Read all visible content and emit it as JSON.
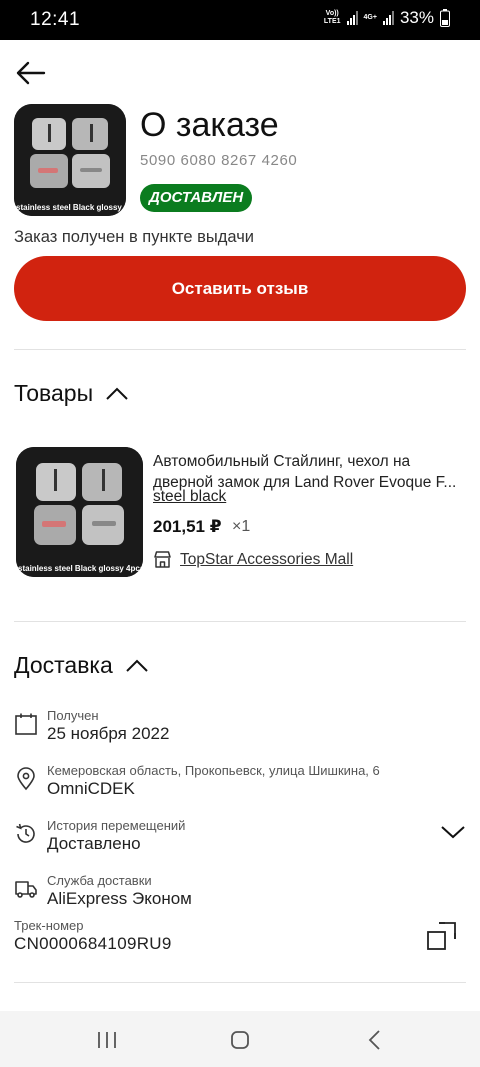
{
  "status_bar": {
    "time": "12:41",
    "network_top": "Vo))",
    "network_bottom": "LTE1",
    "network2": "4G+",
    "battery": "33%"
  },
  "header": {
    "title": "О заказе",
    "order_number": "5090 6080 8267 4260",
    "status_badge": "ДОСТАВЛЕН",
    "note": "Заказ получен в пункте выдачи",
    "review_button": "Оставить отзыв"
  },
  "product_image_caption": "stainless steel Black glossy 4pcs",
  "products": {
    "section_title": "Товары",
    "item": {
      "title": "Автомобильный Стайлинг, чехол на дверной замок для Land Rover Evoque F...",
      "variant": "steel black",
      "price": "201,51 ₽",
      "qty": "×1",
      "store": "TopStar Accessories Mall"
    }
  },
  "delivery": {
    "section_title": "Доставка",
    "received_label": "Получен",
    "received_value": "25 ноября 2022",
    "address_label": "Кемеровская область, Прокопьевск, улица Шишкина, 6",
    "address_value": "OmniCDEK",
    "history_label": "История перемещений",
    "history_value": "Доставлено",
    "service_label": "Служба доставки",
    "service_value": "AliExpress Эконом",
    "track_label": "Трек-номер",
    "track_value": "CN0000684109RU9"
  },
  "colors": {
    "accent": "#d1230f",
    "status_green": "#0b7c1f"
  }
}
